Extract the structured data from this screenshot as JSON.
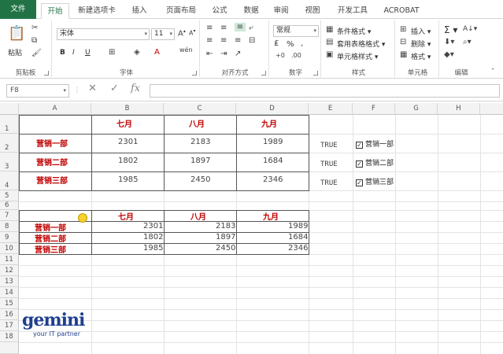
{
  "tabs": [
    "文件",
    "开始",
    "新建选项卡",
    "插入",
    "页面布局",
    "公式",
    "数据",
    "审阅",
    "视图",
    "开发工具",
    "ACROBAT"
  ],
  "ribbon": {
    "clipboard": {
      "paste": "粘贴",
      "label": "剪贴板"
    },
    "font": {
      "name": "宋体",
      "size": "11",
      "label": "字体",
      "bold": "B",
      "italic": "I",
      "underline": "U"
    },
    "alignment": {
      "label": "对齐方式"
    },
    "number": {
      "format": "常规",
      "label": "数字",
      "percent": "%"
    },
    "styles": {
      "conditional": "条件格式",
      "table": "套用表格格式",
      "cell": "单元格样式",
      "label": "样式"
    },
    "cells": {
      "insert": "插入",
      "delete": "删除",
      "format": "格式",
      "label": "单元格"
    },
    "editing": {
      "label": "编辑",
      "sum": "Σ"
    }
  },
  "formula_bar": {
    "name_box": "F8",
    "fx": "fx",
    "value": ""
  },
  "columns": [
    "A",
    "B",
    "C",
    "D",
    "E",
    "F",
    "G",
    "H"
  ],
  "rows": [
    "1",
    "2",
    "3",
    "4",
    "5",
    "6",
    "7",
    "8",
    "9",
    "10",
    "11",
    "12",
    "13",
    "14",
    "15",
    "16",
    "17",
    "18"
  ],
  "table1": {
    "headers": [
      "七月",
      "八月",
      "九月"
    ],
    "rows": [
      {
        "label": "营销一部",
        "values": [
          "2301",
          "2183",
          "1989"
        ]
      },
      {
        "label": "营销二部",
        "values": [
          "1802",
          "1897",
          "1684"
        ]
      },
      {
        "label": "营销三部",
        "values": [
          "1985",
          "2450",
          "2346"
        ]
      }
    ]
  },
  "table2": {
    "headers": [
      "七月",
      "八月",
      "九月"
    ],
    "rows": [
      {
        "label": "营销一部",
        "values": [
          "2301",
          "2183",
          "1989"
        ]
      },
      {
        "label": "营销二部",
        "values": [
          "1802",
          "1897",
          "1684"
        ]
      },
      {
        "label": "营销三部",
        "values": [
          "1985",
          "2450",
          "2346"
        ]
      }
    ]
  },
  "flags": [
    "TRUE",
    "TRUE",
    "TRUE"
  ],
  "checkboxes": [
    {
      "label": "营销一部",
      "checked": true
    },
    {
      "label": "营销二部",
      "checked": true
    },
    {
      "label": "营销三部",
      "checked": true
    }
  ],
  "logo": {
    "word": "gemini",
    "tagline": "your IT partner"
  }
}
